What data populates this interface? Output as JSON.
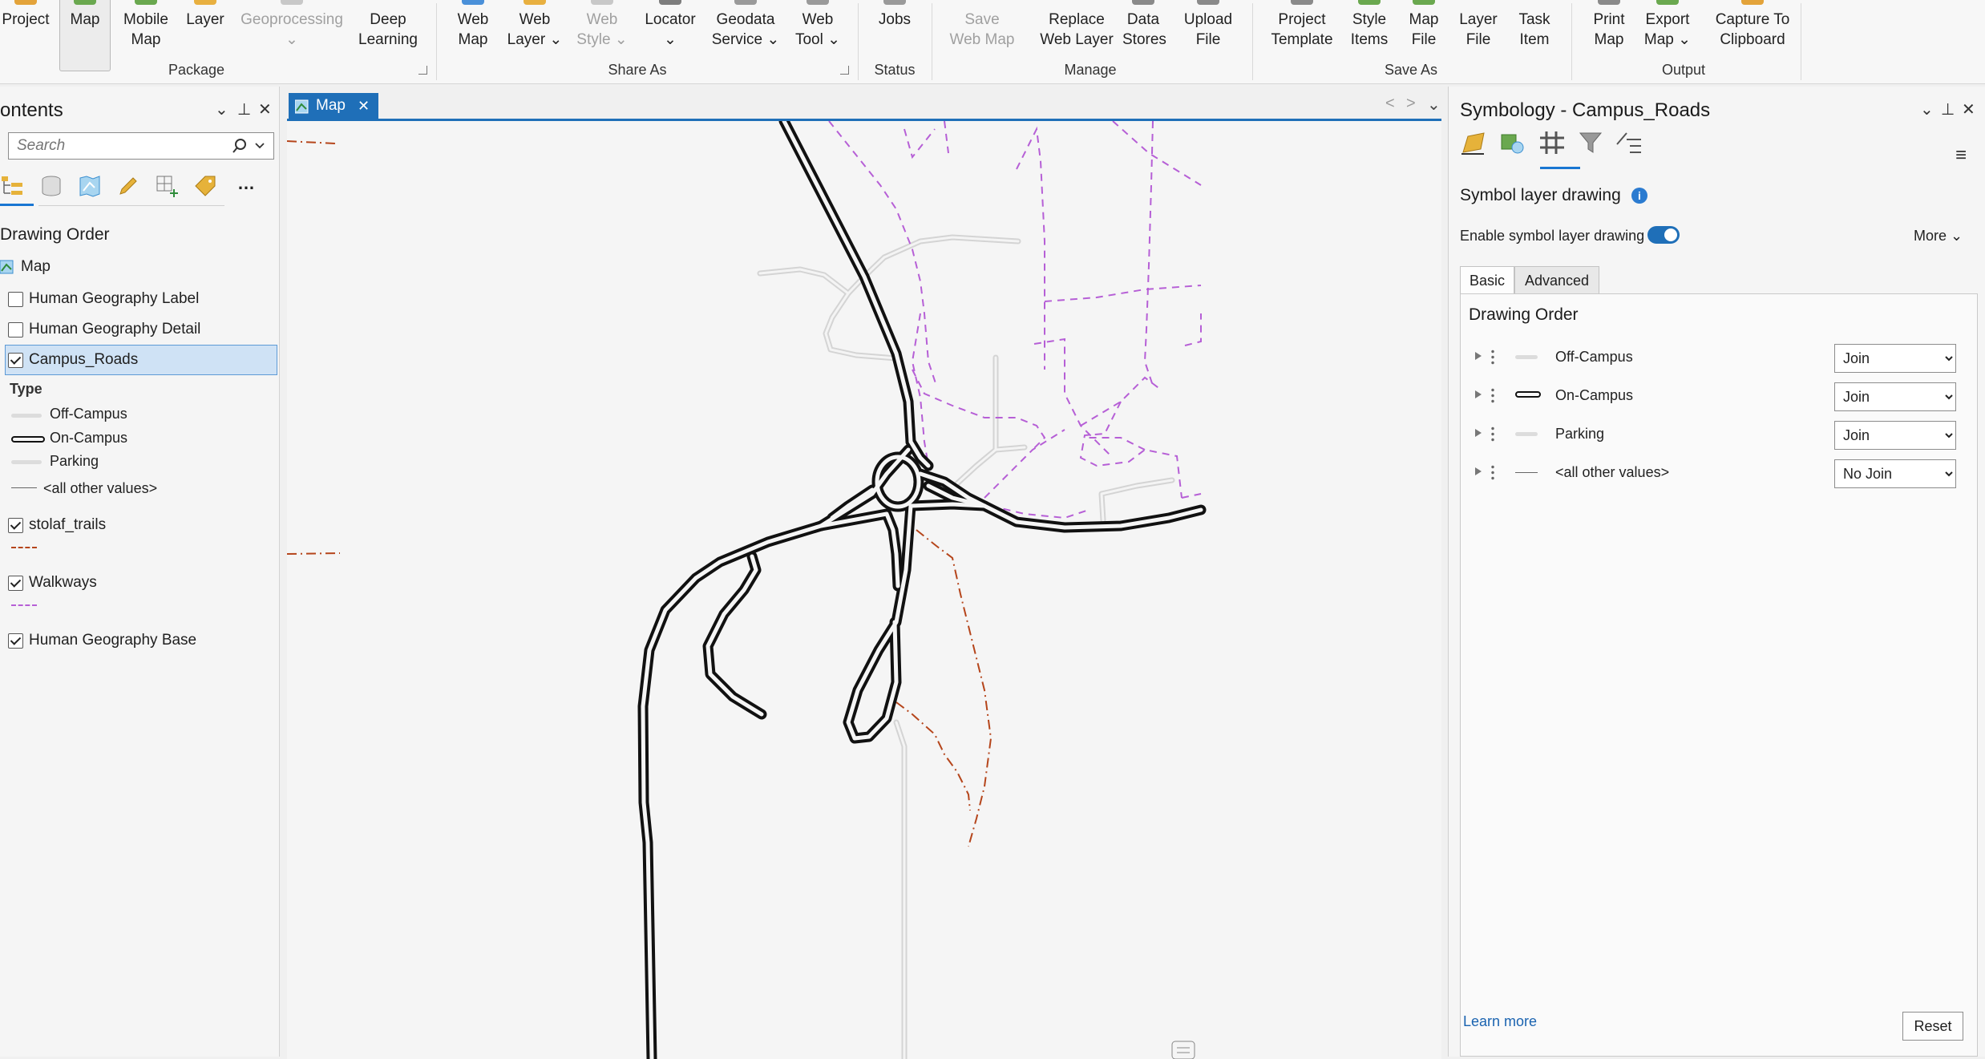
{
  "ribbon": {
    "buttons": [
      {
        "label": "Project",
        "state": "normal"
      },
      {
        "label": "Map",
        "state": "active"
      },
      {
        "label": "Mobile\nMap",
        "state": "normal"
      },
      {
        "label": "Layer",
        "state": "normal"
      },
      {
        "label": "Geoprocessing\n⌄",
        "state": "disabled"
      },
      {
        "label": "Deep\nLearning",
        "state": "normal"
      },
      {
        "label": "Web\nMap",
        "state": "normal"
      },
      {
        "label": "Web\nLayer ⌄",
        "state": "normal"
      },
      {
        "label": "Web\nStyle ⌄",
        "state": "disabled"
      },
      {
        "label": "Locator\n⌄",
        "state": "normal"
      },
      {
        "label": "Geodata\nService ⌄",
        "state": "normal"
      },
      {
        "label": "Web\nTool ⌄",
        "state": "normal"
      },
      {
        "label": "Jobs",
        "state": "normal"
      },
      {
        "label": "Save\nWeb Map",
        "state": "disabled"
      },
      {
        "label": "Replace\nWeb Layer",
        "state": "normal"
      },
      {
        "label": "Data\nStores",
        "state": "normal"
      },
      {
        "label": "Upload\nFile",
        "state": "normal"
      },
      {
        "label": "Project\nTemplate",
        "state": "normal"
      },
      {
        "label": "Style\nItems",
        "state": "normal"
      },
      {
        "label": "Map\nFile",
        "state": "normal"
      },
      {
        "label": "Layer\nFile",
        "state": "normal"
      },
      {
        "label": "Task\nItem",
        "state": "normal"
      },
      {
        "label": "Print\nMap",
        "state": "normal"
      },
      {
        "label": "Export\nMap ⌄",
        "state": "normal"
      },
      {
        "label": "Capture To\nClipboard",
        "state": "normal"
      }
    ],
    "groups": [
      "Package",
      "Share As",
      "Status",
      "Manage",
      "Save As",
      "Output"
    ]
  },
  "contents": {
    "title": "ontents",
    "search_placeholder": "Search",
    "drawing_order": "Drawing Order",
    "map_label": "Map",
    "layers": [
      {
        "label": "Human Geography Label",
        "checked": false
      },
      {
        "label": "Human Geography Detail",
        "checked": false
      },
      {
        "label": "Campus_Roads",
        "checked": true
      },
      {
        "label": "stolaf_trails",
        "checked": true
      },
      {
        "label": "Walkways",
        "checked": true
      },
      {
        "label": "Human Geography Base",
        "checked": true
      }
    ],
    "type_heading": "Type",
    "legend": [
      "Off-Campus",
      "On-Campus",
      "Parking",
      "<all other values>"
    ],
    "colors": {
      "trails": "#b5451b",
      "walkways": "#b65fd6",
      "selection": "#cfe2f5"
    }
  },
  "map": {
    "tab_label": "Map",
    "close_glyph": "✕",
    "nav": {
      "back": "<",
      "forward": ">",
      "menu": "⌄"
    }
  },
  "symbology": {
    "title": "Symbology - Campus_Roads",
    "section": "Symbol layer drawing",
    "enable_label": "Enable symbol layer drawing",
    "enable_on": true,
    "more_label": "More",
    "tabs": [
      "Basic",
      "Advanced"
    ],
    "drawing_order_title": "Drawing Order",
    "rows": [
      {
        "name": "Off-Campus",
        "join": "Join"
      },
      {
        "name": "On-Campus",
        "join": "Join"
      },
      {
        "name": "Parking",
        "join": "Join"
      },
      {
        "name": "<all other values>",
        "join": "No Join"
      }
    ],
    "learn_more": "Learn more",
    "reset": "Reset"
  }
}
